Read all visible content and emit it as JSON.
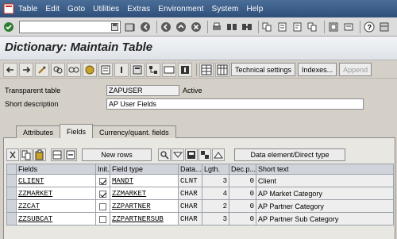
{
  "menubar": {
    "items": [
      "Table",
      "Edit",
      "Goto",
      "Utilities",
      "Extras",
      "Environment",
      "System",
      "Help"
    ],
    "logo_icon": "sap-window-icon"
  },
  "stdbar": {
    "command_value": "",
    "icons": [
      "enter-icon",
      "save-icon",
      "back-icon",
      "exit-icon",
      "cancel-icon",
      "print-icon",
      "find-icon",
      "find-next-icon",
      "first-page-icon",
      "prev-page-icon",
      "next-page-icon",
      "last-page-icon",
      "create-session-icon",
      "shortcut-icon",
      "help-icon",
      "layout-icon"
    ]
  },
  "title": "Dictionary: Maintain Table",
  "appbar": {
    "technical_settings": "Technical settings",
    "indexes": "Indexes...",
    "append": "Append"
  },
  "header": {
    "transparent_table_label": "Transparent table",
    "transparent_table_value": "ZAPUSER",
    "status": "Active",
    "short_description_label": "Short description",
    "short_description_value": "AP User Fields"
  },
  "tabs": [
    {
      "label": "Attributes",
      "active": false
    },
    {
      "label": "Fields",
      "active": true
    },
    {
      "label": "Currency/quant. fields",
      "active": false
    }
  ],
  "table_toolbar": {
    "new_rows": "New rows",
    "data_element": "Data element/Direct type"
  },
  "grid": {
    "columns": [
      "Fields",
      "Init.",
      "Field type",
      "Data...",
      "Lgth.",
      "Dec.p...",
      "Short text"
    ],
    "rows": [
      {
        "field": "CLIENT",
        "init": true,
        "field_type": "MANDT",
        "data_type": "CLNT",
        "length": "3",
        "decimals": "0",
        "short_text": "Client"
      },
      {
        "field": "ZZMARKET",
        "init": true,
        "field_type": "ZZMARKET",
        "data_type": "CHAR",
        "length": "4",
        "decimals": "0",
        "short_text": "AP Market Category"
      },
      {
        "field": "ZZCAT",
        "init": false,
        "field_type": "ZZPARTNER",
        "data_type": "CHAR",
        "length": "2",
        "decimals": "0",
        "short_text": "AP Partner Category"
      },
      {
        "field": "ZZSUBCAT",
        "init": false,
        "field_type": "ZZPARTNERSUB",
        "data_type": "CHAR",
        "length": "3",
        "decimals": "0",
        "short_text": "AP Partner Sub Category"
      }
    ]
  }
}
